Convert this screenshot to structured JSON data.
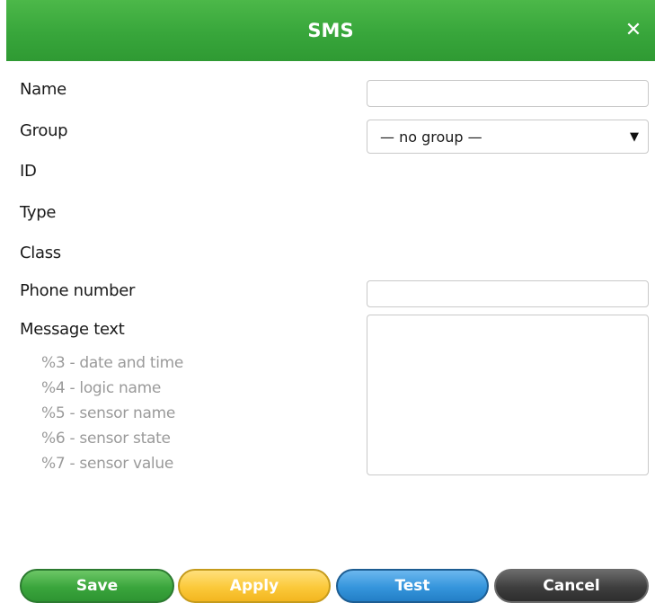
{
  "dialog": {
    "title": "SMS",
    "close_glyph": "✕",
    "title_bar_color": "#3aa83c"
  },
  "form": {
    "name": {
      "label": "Name",
      "value": ""
    },
    "group": {
      "label": "Group",
      "selected": "— no group —",
      "arrow": "▼"
    },
    "id": {
      "label": "ID"
    },
    "type": {
      "label": "Type"
    },
    "class": {
      "label": "Class"
    },
    "phone": {
      "label": "Phone number",
      "value": ""
    },
    "message": {
      "label": "Message text",
      "value": "",
      "hints": [
        "%3 - date and time",
        "%4 - logic name",
        "%5 - sensor name",
        "%6 - sensor state",
        "%7 - sensor value"
      ]
    }
  },
  "buttons": {
    "save": "Save",
    "apply": "Apply",
    "test": "Test",
    "cancel": "Cancel"
  },
  "colors": {
    "save": "#3aa53c",
    "apply": "#fbc93a",
    "test": "#3595dc",
    "cancel": "#3e3e3e"
  },
  "icons": {
    "close": "close-icon",
    "dropdown": "chevron-down-icon"
  }
}
